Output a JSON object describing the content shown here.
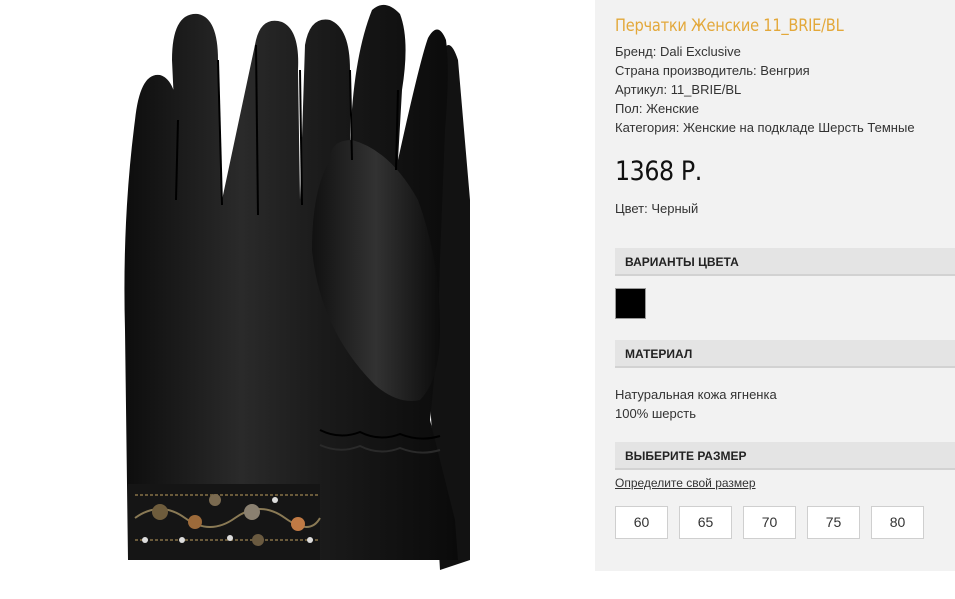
{
  "product": {
    "title": "Перчатки Женские 11_BRIE/BL",
    "brand_line": "Бренд: Dali Exclusive",
    "country_line": "Страна производитель: Венгрия",
    "article_line": "Артикул: 11_BRIE/BL",
    "gender_line": "Пол: Женские",
    "category_line": "Категория: Женские на подкладе Шерсть Темные",
    "price": "1368 Р.",
    "color_line": "Цвет: Черный"
  },
  "sections": {
    "color_variants": "ВАРИАНТЫ ЦВЕТА",
    "material": "МАТЕРИАЛ",
    "size": "ВЫБЕРИТЕ РАЗМЕР"
  },
  "color_swatches": [
    {
      "name": "Черный",
      "hex": "#000000"
    }
  ],
  "material_lines": [
    "Натуральная кожа ягненка",
    "100% шерсть"
  ],
  "size_link": "Определите свой размер",
  "sizes": [
    "60",
    "65",
    "70",
    "75",
    "80"
  ],
  "colors": {
    "title": "#e3a83a",
    "panel_bg": "#f2f2f2",
    "section_bg": "#e4e4e4"
  },
  "image": {
    "alt": "black leather women's gloves with embroidered beaded cuff"
  }
}
